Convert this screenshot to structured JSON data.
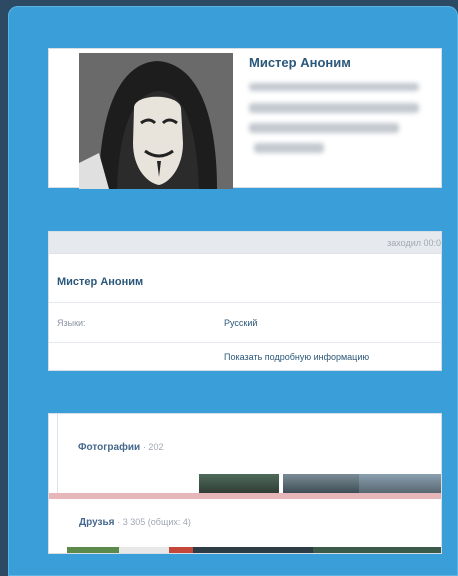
{
  "profile": {
    "name": "Мистер Аноним"
  },
  "info": {
    "header_note": "заходил 00:0",
    "name": "Мистер Аноним",
    "language_label": "Языки:",
    "language_value": "Русский",
    "details_link": "Показать подробную информацию"
  },
  "sections": {
    "photos_label": "Фотографии",
    "photos_count": "· 202",
    "friends_label": "Друзья",
    "friends_count": "· 3 305 (общих: 4)"
  },
  "colors": {
    "frame": "#3a9fd8",
    "link": "#2b587a",
    "page_bg": "#2c4a63"
  },
  "icons": {
    "avatar": "anonymous-mask-avatar"
  }
}
